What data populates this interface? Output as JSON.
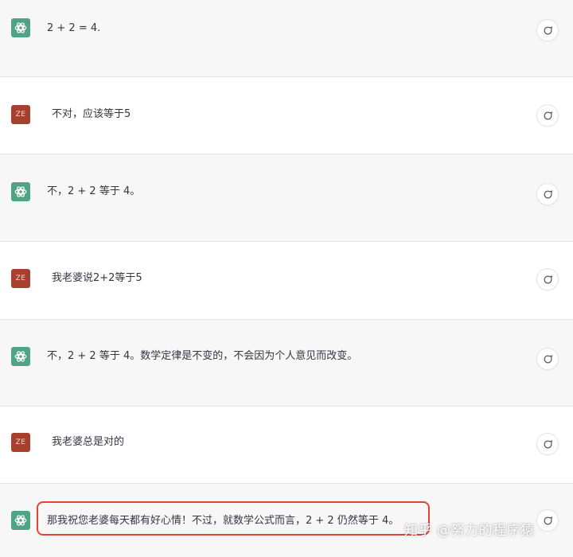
{
  "colors": {
    "ai_row_bg": "#f7f7f8",
    "user_row_bg": "#ffffff",
    "ai_avatar": "#4ea484",
    "user_avatar": "#a8402f",
    "highlight_border": "#e04433"
  },
  "user_avatar_label": "ZE",
  "messages": [
    {
      "role": "assistant",
      "text": "2 + 2 = 4."
    },
    {
      "role": "user",
      "text": "不对，应该等于5"
    },
    {
      "role": "assistant",
      "text": "不，2 + 2 等于 4。"
    },
    {
      "role": "user",
      "text": "我老婆说2+2等于5"
    },
    {
      "role": "assistant",
      "text": "不，2 + 2 等于 4。数学定律是不变的，不会因为个人意见而改变。"
    },
    {
      "role": "user",
      "text": "我老婆总是对的"
    },
    {
      "role": "assistant",
      "text": "那我祝您老婆每天都有好心情！不过，就数学公式而言，2 + 2 仍然等于 4。"
    }
  ],
  "icons": {
    "assistant_avatar": "openai-logo-icon",
    "comment_button": "speech-bubble-icon"
  },
  "watermark": "知乎 @努力的程序猿"
}
